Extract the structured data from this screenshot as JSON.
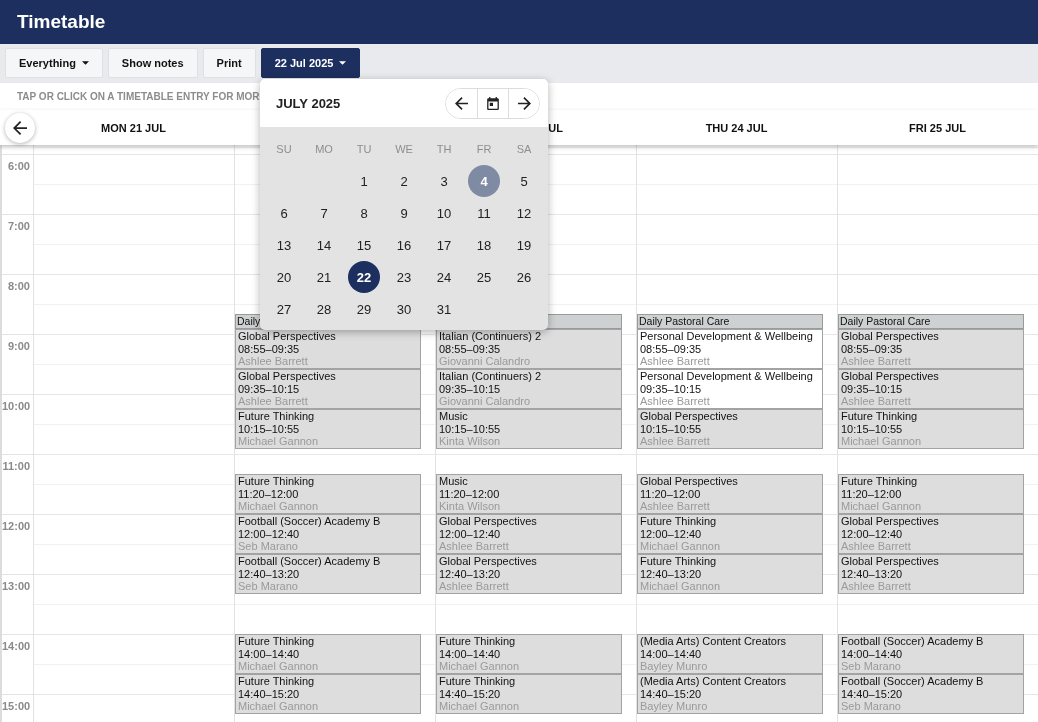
{
  "header": {
    "title": "Timetable"
  },
  "toolbar": {
    "buttons": [
      {
        "label": "Everything",
        "dropdown": true,
        "open": false
      },
      {
        "label": "Show notes",
        "dropdown": false,
        "open": false
      },
      {
        "label": "Print",
        "dropdown": false,
        "open": false
      },
      {
        "label": "22 Jul 2025",
        "dropdown": true,
        "open": true
      }
    ]
  },
  "hint": "TAP OR CLICK ON A TIMETABLE ENTRY FOR MOR",
  "date_picker": {
    "title": "JULY 2025",
    "weekdays": [
      "SU",
      "MO",
      "TU",
      "WE",
      "TH",
      "FR",
      "SA"
    ],
    "weeks": [
      {
        "days": [
          {
            "label": "1",
            "selected": false,
            "highlighted": false
          },
          {
            "label": "2",
            "selected": false,
            "highlighted": false
          },
          {
            "label": "3",
            "selected": false,
            "highlighted": false
          },
          {
            "label": "4",
            "selected": false,
            "highlighted": true
          },
          {
            "label": "5",
            "selected": false,
            "highlighted": false
          }
        ]
      },
      {
        "days": [
          {
            "label": "6",
            "selected": false,
            "highlighted": false
          },
          {
            "label": "7",
            "selected": false,
            "highlighted": false
          },
          {
            "label": "8",
            "selected": false,
            "highlighted": false
          },
          {
            "label": "9",
            "selected": false,
            "highlighted": false
          },
          {
            "label": "10",
            "selected": false,
            "highlighted": false
          },
          {
            "label": "11",
            "selected": false,
            "highlighted": false
          },
          {
            "label": "12",
            "selected": false,
            "highlighted": false
          }
        ]
      },
      {
        "days": [
          {
            "label": "13",
            "selected": false,
            "highlighted": false
          },
          {
            "label": "14",
            "selected": false,
            "highlighted": false
          },
          {
            "label": "15",
            "selected": false,
            "highlighted": false
          },
          {
            "label": "16",
            "selected": false,
            "highlighted": false
          },
          {
            "label": "17",
            "selected": false,
            "highlighted": false
          },
          {
            "label": "18",
            "selected": false,
            "highlighted": false
          },
          {
            "label": "19",
            "selected": false,
            "highlighted": false
          }
        ]
      },
      {
        "days": [
          {
            "label": "20",
            "selected": false,
            "highlighted": false
          },
          {
            "label": "21",
            "selected": false,
            "highlighted": false
          },
          {
            "label": "22",
            "selected": true,
            "highlighted": false
          },
          {
            "label": "23",
            "selected": false,
            "highlighted": false
          },
          {
            "label": "24",
            "selected": false,
            "highlighted": false
          },
          {
            "label": "25",
            "selected": false,
            "highlighted": false
          },
          {
            "label": "26",
            "selected": false,
            "highlighted": false
          }
        ]
      },
      {
        "days": [
          {
            "label": "27",
            "selected": false,
            "highlighted": false
          },
          {
            "label": "28",
            "selected": false,
            "highlighted": false
          },
          {
            "label": "29",
            "selected": false,
            "highlighted": false
          },
          {
            "label": "30",
            "selected": false,
            "highlighted": false
          },
          {
            "label": "31",
            "selected": false,
            "highlighted": false
          }
        ]
      }
    ]
  },
  "timetable": {
    "times": [
      "6:00",
      "7:00",
      "8:00",
      "9:00",
      "10:00",
      "11:00",
      "12:00",
      "13:00",
      "14:00",
      "15:00"
    ],
    "days": [
      {
        "label": "MON 21 JUL",
        "cut_off": false
      },
      {
        "sessions": [
          {
            "entries": [
              {
                "kind": "bar",
                "title": "Daily",
                "color": "#cdd1d1"
              },
              {
                "kind": "lesson",
                "title": "Global Perspectives",
                "time": "08:55–09:35",
                "teacher": "Ashlee Barrett",
                "color": "#dddddd"
              },
              {
                "kind": "lesson",
                "title": "Global Perspectives",
                "time": "09:35–10:15",
                "teacher": "Ashlee Barrett",
                "color": "#dddddd"
              },
              {
                "kind": "lesson",
                "title": "Future Thinking",
                "time": "10:15–10:55",
                "teacher": "Michael Gannon",
                "color": "#dddddd"
              }
            ]
          },
          {
            "entries": [
              {
                "kind": "lesson",
                "title": "Future Thinking",
                "time": "11:20–12:00",
                "teacher": "Michael Gannon",
                "color": "#dddddd"
              },
              {
                "kind": "lesson",
                "title": "Football (Soccer) Academy B",
                "time": "12:00–12:40",
                "teacher": "Seb Marano",
                "color": "#dddddd"
              },
              {
                "kind": "lesson",
                "title": "Football (Soccer) Academy B",
                "time": "12:40–13:20",
                "teacher": "Seb Marano",
                "color": "#dddddd"
              }
            ]
          },
          {
            "entries": [
              {
                "kind": "lesson",
                "title": "Future Thinking",
                "time": "14:00–14:40",
                "teacher": "Michael Gannon",
                "color": "#dddddd"
              },
              {
                "kind": "lesson",
                "title": "Future Thinking",
                "time": "14:40–15:20",
                "teacher": "Michael Gannon",
                "color": "#dddddd"
              }
            ]
          }
        ]
      },
      {
        "label": "UL",
        "cut_off": true,
        "sessions": [
          {
            "entries": [
              {
                "kind": "bar",
                "color": "#cdd1d1"
              },
              {
                "kind": "lesson",
                "title": "Italian (Continuers) 2",
                "time": "08:55–09:35",
                "teacher": "Giovanni Calandro",
                "color": "#dddddd"
              },
              {
                "kind": "lesson",
                "title": "Italian (Continuers) 2",
                "time": "09:35–10:15",
                "teacher": "Giovanni Calandro",
                "color": "#dddddd"
              },
              {
                "kind": "lesson",
                "title": "Music",
                "time": "10:15–10:55",
                "teacher": "Kinta Wilson",
                "color": "#dddddd"
              }
            ]
          },
          {
            "entries": [
              {
                "kind": "lesson",
                "title": "Music",
                "time": "11:20–12:00",
                "teacher": "Kinta Wilson",
                "color": "#dddddd"
              },
              {
                "kind": "lesson",
                "title": "Global Perspectives",
                "time": "12:00–12:40",
                "teacher": "Ashlee Barrett",
                "color": "#dddddd"
              },
              {
                "kind": "lesson",
                "title": "Global Perspectives",
                "time": "12:40–13:20",
                "teacher": "Ashlee Barrett",
                "color": "#dddddd"
              }
            ]
          },
          {
            "entries": [
              {
                "kind": "lesson",
                "title": "Future Thinking",
                "time": "14:00–14:40",
                "teacher": "Michael Gannon",
                "color": "#dddddd"
              },
              {
                "kind": "lesson",
                "title": "Future Thinking",
                "time": "14:40–15:20",
                "teacher": "Michael Gannon",
                "color": "#dddddd"
              }
            ]
          }
        ]
      },
      {
        "label": "THU 24 JUL",
        "cut_off": false,
        "sessions": [
          {
            "entries": [
              {
                "kind": "bar",
                "title": "Daily Pastoral Care",
                "color": "#cdd1d1"
              },
              {
                "kind": "lesson",
                "title": "Personal Development & Wellbeing",
                "time": "08:55–09:35",
                "teacher": "Ashlee Barrett",
                "color": "#ffffff"
              },
              {
                "kind": "lesson",
                "title": "Personal Development & Wellbeing",
                "time": "09:35–10:15",
                "teacher": "Ashlee Barrett",
                "color": "#ffffff"
              },
              {
                "kind": "lesson",
                "title": "Global Perspectives",
                "time": "10:15–10:55",
                "teacher": "Ashlee Barrett",
                "color": "#dddddd"
              }
            ]
          },
          {
            "entries": [
              {
                "kind": "lesson",
                "title": "Global Perspectives",
                "time": "11:20–12:00",
                "teacher": "Ashlee Barrett",
                "color": "#dddddd"
              },
              {
                "kind": "lesson",
                "title": "Future Thinking",
                "time": "12:00–12:40",
                "teacher": "Michael Gannon",
                "color": "#dddddd"
              },
              {
                "kind": "lesson",
                "title": "Future Thinking",
                "time": "12:40–13:20",
                "teacher": "Michael Gannon",
                "color": "#dddddd"
              }
            ]
          },
          {
            "entries": [
              {
                "kind": "lesson",
                "title": "(Media Arts) Content Creators",
                "time": "14:00–14:40",
                "teacher": "Bayley Munro",
                "color": "#dddddd"
              },
              {
                "kind": "lesson",
                "title": "(Media Arts) Content Creators",
                "time": "14:40–15:20",
                "teacher": "Bayley Munro",
                "color": "#dddddd"
              }
            ]
          }
        ]
      },
      {
        "label": "FRI 25 JUL",
        "cut_off": false,
        "sessions": [
          {
            "entries": [
              {
                "kind": "bar",
                "title": "Daily Pastoral Care",
                "color": "#cdd1d1"
              },
              {
                "kind": "lesson",
                "title": "Global Perspectives",
                "time": "08:55–09:35",
                "teacher": "Ashlee Barrett",
                "color": "#dddddd"
              },
              {
                "kind": "lesson",
                "title": "Global Perspectives",
                "time": "09:35–10:15",
                "teacher": "Ashlee Barrett",
                "color": "#dddddd"
              },
              {
                "kind": "lesson",
                "title": "Future Thinking",
                "time": "10:15–10:55",
                "teacher": "Michael Gannon",
                "color": "#dddddd"
              }
            ]
          },
          {
            "entries": [
              {
                "kind": "lesson",
                "title": "Future Thinking",
                "time": "11:20–12:00",
                "teacher": "Michael Gannon",
                "color": "#dddddd"
              },
              {
                "kind": "lesson",
                "title": "Global Perspectives",
                "time": "12:00–12:40",
                "teacher": "Ashlee Barrett",
                "color": "#dddddd"
              },
              {
                "kind": "lesson",
                "title": "Global Perspectives",
                "time": "12:40–13:20",
                "teacher": "Ashlee Barrett",
                "color": "#dddddd"
              }
            ]
          },
          {
            "entries": [
              {
                "kind": "lesson",
                "title": "Football (Soccer) Academy B",
                "time": "14:00–14:40",
                "teacher": "Seb Marano",
                "color": "#dddddd"
              },
              {
                "kind": "lesson",
                "title": "Football (Soccer) Academy B",
                "time": "14:40–15:20",
                "teacher": "Seb Marano",
                "color": "#dddddd"
              }
            ]
          }
        ]
      }
    ]
  }
}
